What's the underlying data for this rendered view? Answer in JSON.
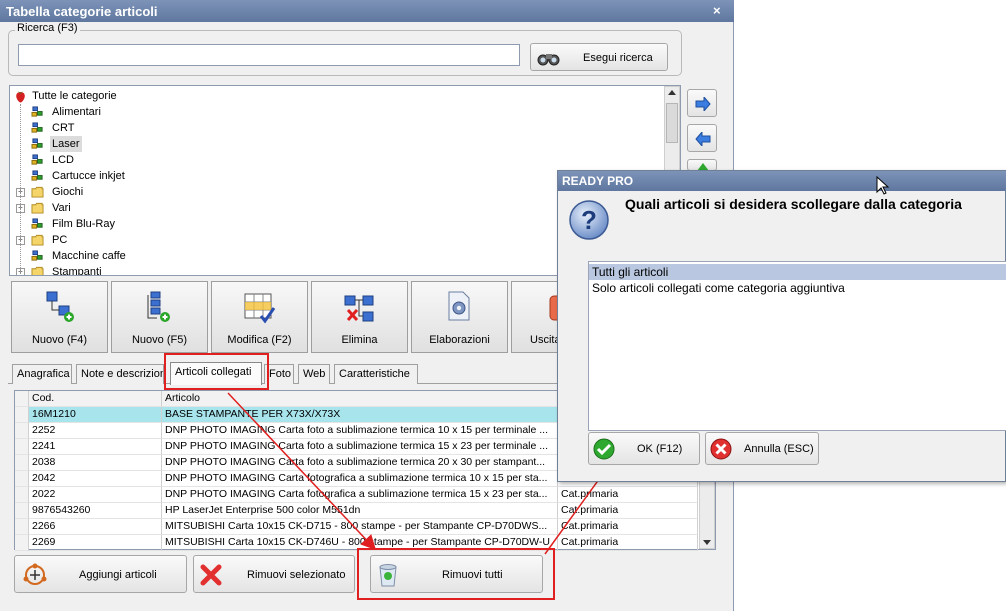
{
  "main_window": {
    "title": "Tabella categorie articoli",
    "close_glyph": "×"
  },
  "search": {
    "group_label": "Ricerca (F3)",
    "value": "",
    "button_label": "Esegui ricerca",
    "button_icon": "binoculars-icon"
  },
  "tree": {
    "root_label": "Tutte le categorie",
    "items": [
      {
        "label": "Alimentari",
        "icon": "category-icon",
        "expandable": false,
        "selected": false
      },
      {
        "label": "CRT",
        "icon": "category-icon",
        "expandable": false,
        "selected": false
      },
      {
        "label": "Laser",
        "icon": "category-icon",
        "expandable": false,
        "selected": true
      },
      {
        "label": "LCD",
        "icon": "category-icon",
        "expandable": false,
        "selected": false
      },
      {
        "label": "Cartucce inkjet",
        "icon": "category-icon",
        "expandable": false,
        "selected": false
      },
      {
        "label": "Giochi",
        "icon": "folder-icon",
        "expandable": true,
        "selected": false
      },
      {
        "label": "Vari",
        "icon": "folder-icon",
        "expandable": true,
        "selected": false
      },
      {
        "label": "Film Blu-Ray",
        "icon": "category-icon",
        "expandable": false,
        "selected": false
      },
      {
        "label": "PC",
        "icon": "folder-icon",
        "expandable": true,
        "selected": false
      },
      {
        "label": "Macchine caffe",
        "icon": "category-icon",
        "expandable": false,
        "selected": false
      },
      {
        "label": "Stampanti",
        "icon": "folder-icon",
        "expandable": true,
        "selected": false
      }
    ]
  },
  "side_buttons": [
    {
      "name": "move-right-button",
      "icon": "arrow-right-icon"
    },
    {
      "name": "move-left-button",
      "icon": "arrow-left-icon"
    }
  ],
  "toolbar": {
    "buttons": [
      {
        "label": "Nuovo (F4)",
        "icon": "new-category-icon"
      },
      {
        "label": "Nuovo (F5)",
        "icon": "new-subcategory-icon"
      },
      {
        "label": "Modifica (F2)",
        "icon": "edit-grid-icon"
      },
      {
        "label": "Elimina",
        "icon": "delete-node-icon"
      },
      {
        "label": "Elaborazioni",
        "icon": "gear-document-icon"
      },
      {
        "label": "Uscita",
        "icon": "exit-icon"
      }
    ]
  },
  "tabs": [
    {
      "label": "Anagrafica",
      "active": false
    },
    {
      "label": "Note e descrizion",
      "active": false
    },
    {
      "label": "Articoli collegati",
      "active": true
    },
    {
      "label": "Foto",
      "active": false
    },
    {
      "label": "Web",
      "active": false
    },
    {
      "label": "Caratteristiche",
      "active": false
    }
  ],
  "grid": {
    "columns": [
      "Cod.",
      "Articolo",
      ""
    ],
    "rows": [
      {
        "cod": "16M1210",
        "articolo": "BASE STAMPANTE PER X73X/X73X",
        "cat": "",
        "highlight": true
      },
      {
        "cod": "2252",
        "articolo": "DNP PHOTO IMAGING Carta foto a sublimazione termica 10 x 15 per terminale ...",
        "cat": "",
        "highlight": false
      },
      {
        "cod": "2241",
        "articolo": "DNP PHOTO IMAGING Carta foto a sublimazione termica 15 x 23 per terminale ...",
        "cat": "",
        "highlight": false
      },
      {
        "cod": "2038",
        "articolo": "DNP PHOTO IMAGING Carta foto a sublimazione termica 20 x 30 per stampant...",
        "cat": "",
        "highlight": false
      },
      {
        "cod": "2042",
        "articolo": "DNP PHOTO IMAGING Carta fotografica a sublimazione termica 10 x 15 per sta...",
        "cat": "",
        "highlight": false
      },
      {
        "cod": "2022",
        "articolo": "DNP PHOTO IMAGING Carta fotografica a sublimazione termica 15 x 23 per sta...",
        "cat": "Cat.primaria",
        "highlight": false
      },
      {
        "cod": "9876543260",
        "articolo": "HP LaserJet Enterprise 500 color M551dn",
        "cat": "Cat.primaria",
        "highlight": false
      },
      {
        "cod": "2266",
        "articolo": "MITSUBISHI Carta 10x15 CK-D715 - 800 stampe - per Stampante CP-D70DWS...",
        "cat": "Cat.primaria",
        "highlight": false
      },
      {
        "cod": "2269",
        "articolo": "MITSUBISHI Carta 10x15 CK-D746U - 800 stampe - per Stampante CP-D70DW-U",
        "cat": "Cat.primaria",
        "highlight": false
      }
    ]
  },
  "bottom_buttons": [
    {
      "label": "Aggiungi articoli",
      "icon": "add-articles-icon"
    },
    {
      "label": "Rimuovi selezionato",
      "icon": "red-x-icon"
    },
    {
      "label": "Rimuovi tutti",
      "icon": "recycle-bin-icon"
    }
  ],
  "dialog": {
    "title": "READY PRO",
    "question": "Quali articoli si desidera scollegare dalla categoria",
    "options": [
      {
        "label": "Tutti gli articoli",
        "selected": true
      },
      {
        "label": "Solo articoli collegati come categoria aggiuntiva",
        "selected": false
      }
    ],
    "ok_label": "OK (F12)",
    "cancel_label": "Annulla (ESC)"
  },
  "colors": {
    "title_bar": "#6a82aa",
    "highlight_row": "#a8e4ec",
    "selection": "#c9d6ea",
    "annotation_red": "#e02020"
  }
}
